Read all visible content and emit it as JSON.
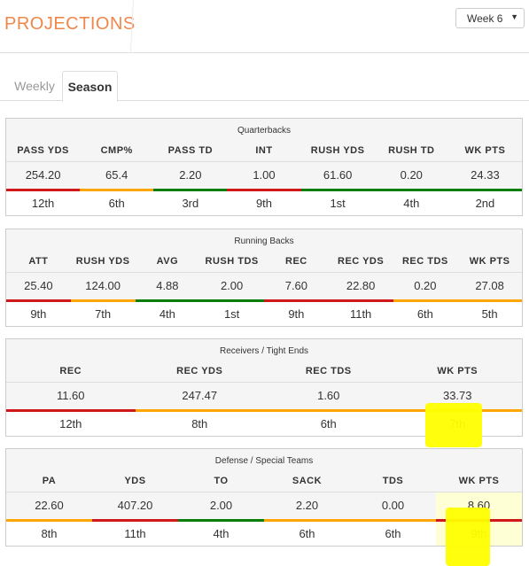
{
  "header": {
    "title": "PROJECTIONS",
    "week_select": {
      "selected": "Week 6",
      "caret_icon": "▼"
    }
  },
  "tabs": [
    {
      "label": "Weekly",
      "active": false
    },
    {
      "label": "Season",
      "active": true
    }
  ],
  "colors": {
    "accent": "#f0874a",
    "good": "#0a7e0a",
    "average": "#ffa500",
    "bad": "#d0181a",
    "highlight": "#ffff00"
  },
  "panels": {
    "qb": {
      "title": "Quarterbacks",
      "columns": [
        "PASS YDS",
        "CMP%",
        "PASS TD",
        "INT",
        "RUSH YDS",
        "RUSH TD",
        "WK PTS"
      ],
      "values": [
        "254.20",
        "65.4",
        "2.20",
        "1.00",
        "61.60",
        "0.20",
        "24.33"
      ],
      "ranks": [
        "12th",
        "6th",
        "3rd",
        "9th",
        "1st",
        "4th",
        "2nd"
      ],
      "rating": [
        "bad",
        "average",
        "good",
        "bad",
        "good",
        "good",
        "good"
      ]
    },
    "rb": {
      "title": "Running Backs",
      "columns": [
        "ATT",
        "RUSH YDS",
        "AVG",
        "RUSH TDS",
        "REC",
        "REC YDS",
        "REC TDS",
        "WK PTS"
      ],
      "values": [
        "25.40",
        "124.00",
        "4.88",
        "2.00",
        "7.60",
        "22.80",
        "0.20",
        "27.08"
      ],
      "ranks": [
        "9th",
        "7th",
        "4th",
        "1st",
        "9th",
        "11th",
        "6th",
        "5th"
      ],
      "rating": [
        "bad",
        "average",
        "good",
        "good",
        "bad",
        "bad",
        "average",
        "average"
      ]
    },
    "wr": {
      "title": "Receivers / Tight Ends",
      "columns": [
        "REC",
        "REC YDS",
        "REC TDS",
        "WK PTS"
      ],
      "values": [
        "11.60",
        "247.47",
        "1.60",
        "33.73"
      ],
      "ranks": [
        "12th",
        "8th",
        "6th",
        "7th"
      ],
      "rating": [
        "bad",
        "average",
        "average",
        "average"
      ]
    },
    "dst": {
      "title": "Defense / Special Teams",
      "columns": [
        "PA",
        "YDS",
        "TO",
        "SACK",
        "TDS",
        "WK PTS"
      ],
      "values": [
        "22.60",
        "407.20",
        "2.00",
        "2.20",
        "0.00",
        "8.60"
      ],
      "ranks": [
        "8th",
        "11th",
        "4th",
        "6th",
        "6th",
        "9th"
      ],
      "rating": [
        "average",
        "bad",
        "good",
        "average",
        "average",
        "bad"
      ]
    }
  }
}
